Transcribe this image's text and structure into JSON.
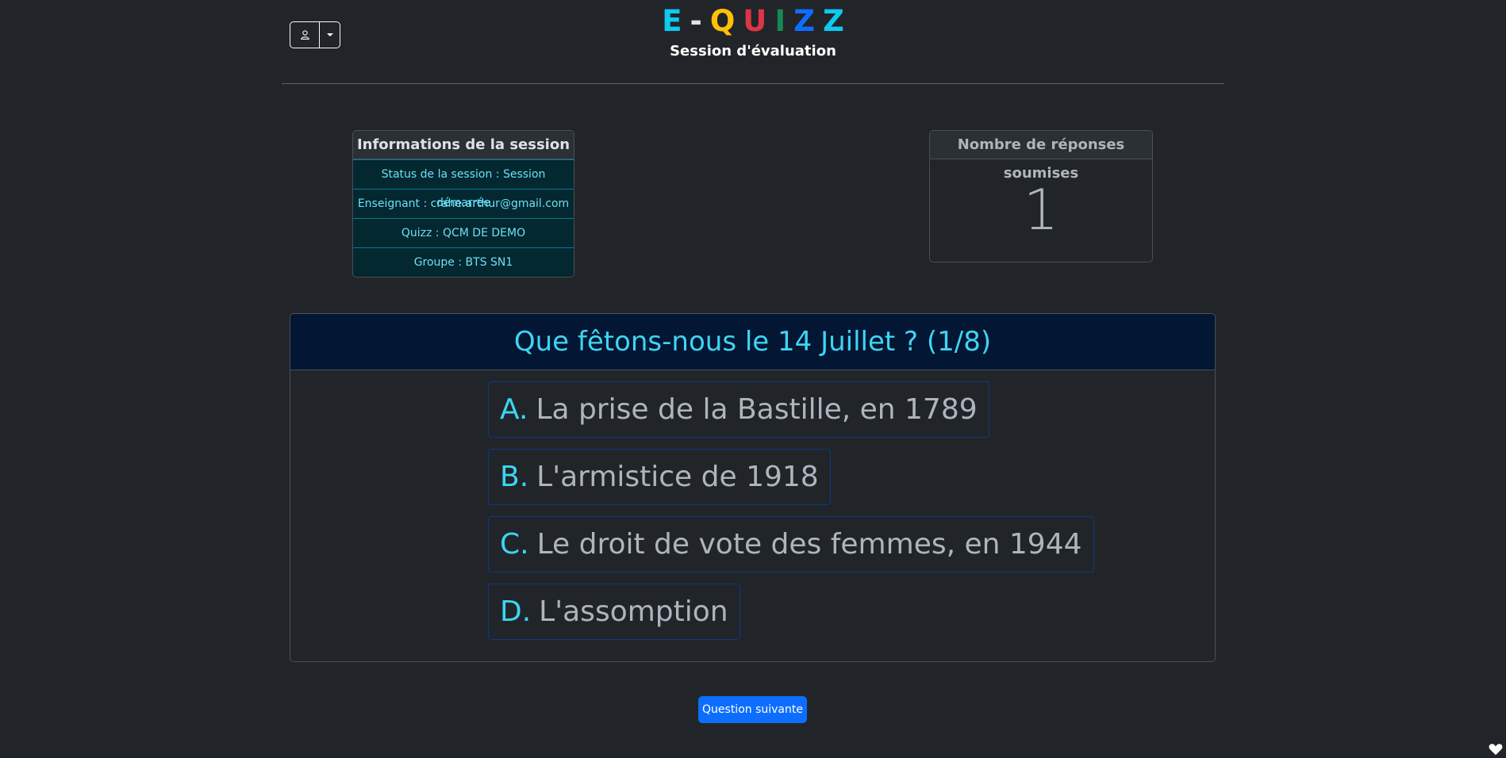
{
  "header": {
    "brand_letters": [
      {
        "char": "E",
        "color": "#0dcaf0"
      },
      {
        "char": "-",
        "color": "#dee2e6"
      },
      {
        "char": "Q",
        "color": "#ffc107"
      },
      {
        "char": "U",
        "color": "#dc3545"
      },
      {
        "char": "I",
        "color": "#198754"
      },
      {
        "char": "Z",
        "color": "#0d6efd"
      },
      {
        "char": "Z",
        "color": "#0dcaf0"
      }
    ],
    "subtitle": "Session d'évaluation",
    "user_icon": "person-icon",
    "dropdown_icon": "caret-down-icon"
  },
  "session_info": {
    "title": "Informations de la session",
    "rows": [
      "Status de la session : Session démarrée",
      "Enseignant : crahe.arthur@gmail.com",
      "Quizz : QCM DE DEMO",
      "Groupe : BTS SN1"
    ]
  },
  "responses": {
    "title": "Nombre de réponses soumises",
    "count": "1"
  },
  "question": {
    "text": "Que fêtons-nous le 14 Juillet ? (1/8)",
    "answers": [
      {
        "letter": "A.",
        "text": "La prise de la Bastille, en 1789"
      },
      {
        "letter": "B.",
        "text": "L'armistice de 1918"
      },
      {
        "letter": "C.",
        "text": "Le droit de vote des femmes, en 1944"
      },
      {
        "letter": "D.",
        "text": "L'assomption"
      }
    ]
  },
  "actions": {
    "next_label": "Question suivante"
  },
  "footer": {
    "icon": "heart-icon"
  }
}
